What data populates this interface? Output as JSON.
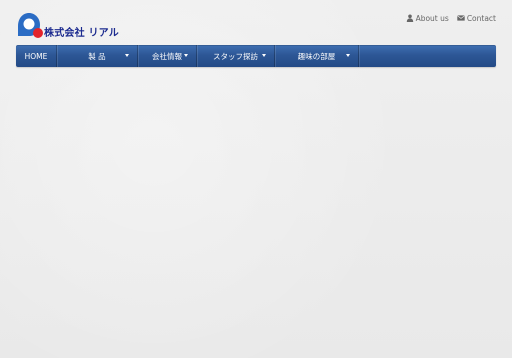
{
  "brand": {
    "name": "株式会社 リアル",
    "colors": {
      "mark_blue": "#2b6cc4",
      "mark_red": "#e3242b",
      "text": "#1b2a8f"
    }
  },
  "top_links": [
    {
      "label": "About us",
      "icon": "user-icon"
    },
    {
      "label": "Contact",
      "icon": "envelope-icon"
    }
  ],
  "nav": {
    "items": [
      {
        "label": "HOME",
        "has_caret": false
      },
      {
        "label": "製 品",
        "has_caret": true
      },
      {
        "label": "会社情報",
        "has_caret": true
      },
      {
        "label": "スタッフ探訪",
        "has_caret": true
      },
      {
        "label": "趣味の部屋",
        "has_caret": true
      }
    ],
    "colors": {
      "bar": "#2d5796",
      "text": "#ffffff"
    }
  }
}
